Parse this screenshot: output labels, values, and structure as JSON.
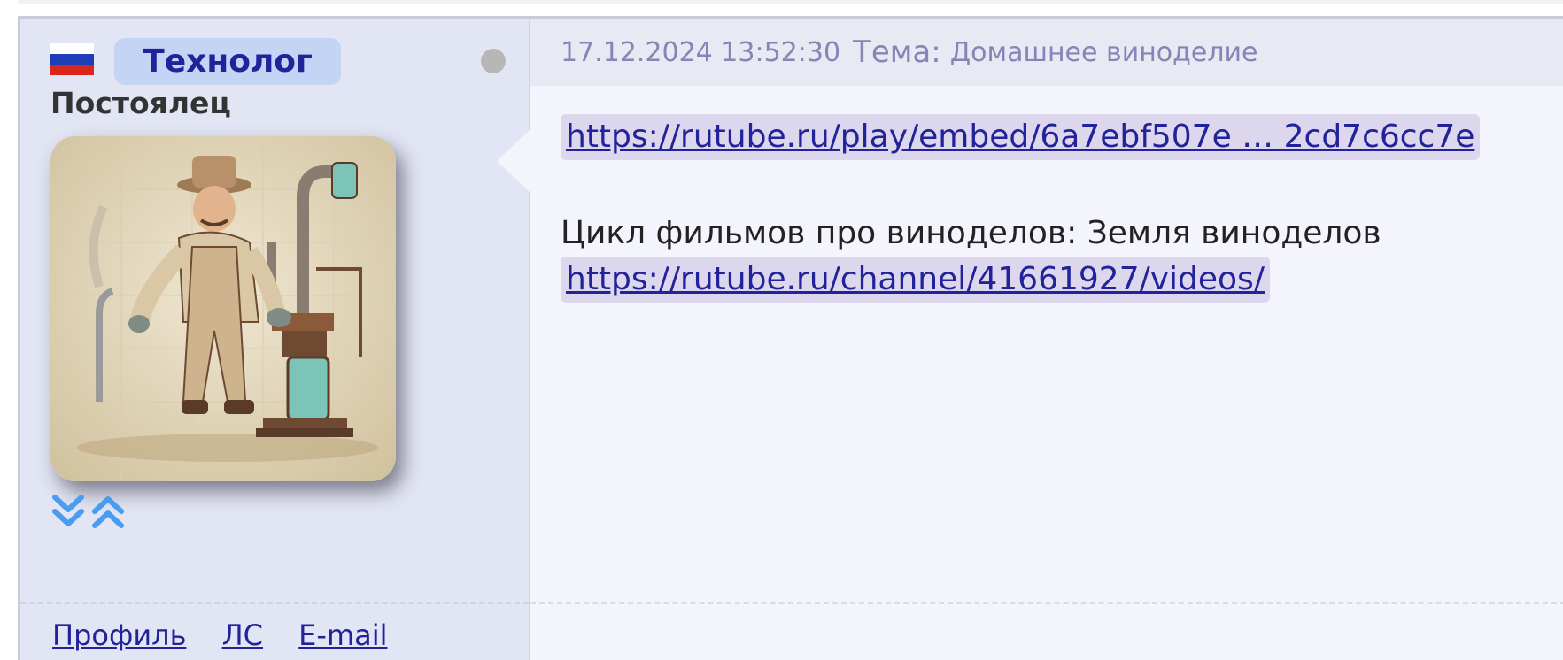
{
  "user": {
    "country_flag": "russia-flag",
    "nickname": "Технолог",
    "rank": "Постоялец",
    "status": "offline",
    "avatar": "avatar-engineer-illustration",
    "reputation_icons": [
      "chevron-double-down-icon",
      "chevron-double-up-icon"
    ]
  },
  "post": {
    "datetime": "17.12.2024 13:52:30",
    "topic_label": "Тема:",
    "topic": "Домашнее виноделие",
    "link1": "https://rutube.ru/play/embed/6a7ebf507e … 2cd7c6cc7e",
    "text": "Цикл фильмов про виноделов: Земля виноделов",
    "link2": "https://rutube.ru/channel/41661927/videos/"
  },
  "footer": {
    "profile": "Профиль",
    "pm": "ЛС",
    "email": "E-mail"
  },
  "colors": {
    "nick_text": "#22229a",
    "nick_bg": "#c4d4f4",
    "left_panel_bg": "#e2e5f3",
    "post_bg": "#f4f4fc",
    "header_text": "#8585b8",
    "link": "#22229a",
    "link_bg": "#ddd7ee",
    "arrow_blue": "#4a9cf0"
  }
}
